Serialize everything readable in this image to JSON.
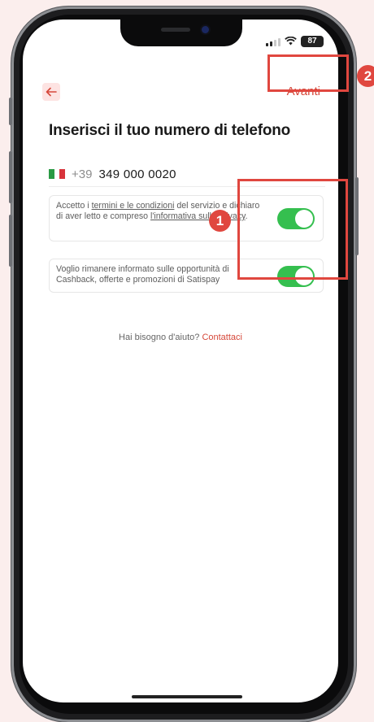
{
  "status_bar": {
    "battery": "87",
    "signal_icon": "cellular-signal-icon",
    "wifi_icon": "wifi-icon"
  },
  "header": {
    "back_icon": "arrow-left-icon",
    "next_label": "Avanti"
  },
  "title": "Inserisci il tuo numero di telefono",
  "phone": {
    "country_flag": "italy-flag-icon",
    "prefix": "+39",
    "number": "349 000 0020"
  },
  "consents": [
    {
      "text_before": "Accetto i ",
      "link1": "termini e le condizioni",
      "text_middle": " del servizio e dichiaro di aver letto e compreso ",
      "link2": "l'informativa sulla privacy",
      "text_after": ".",
      "enabled": true
    },
    {
      "text": "Voglio rimanere informato sulle opportunità di Cashback, offerte e promozioni di Satispay",
      "enabled": true
    }
  ],
  "help": {
    "question": "Hai bisogno d'aiuto?",
    "contact": "Contattaci"
  },
  "annotations": {
    "badge1": "1",
    "badge2": "2"
  },
  "colors": {
    "accent": "#d6483a",
    "toggle_on": "#35bf4f",
    "annotation": "#e0473f",
    "background": "#fbeeed"
  }
}
